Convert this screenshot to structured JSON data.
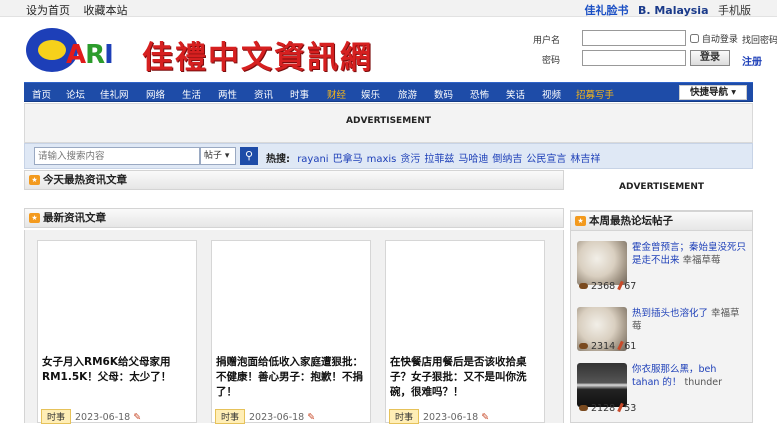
{
  "topbar": {
    "set_home": "设为首页",
    "bookmark": "收藏本站",
    "facebook": "佳礼脸书",
    "malaysia": "B. Malaysia",
    "mobile": "手机版"
  },
  "header": {
    "logo_text": "CARI",
    "site_name": "佳禮中文資訊網"
  },
  "login": {
    "username_label": "用户名",
    "password_label": "密码",
    "auto_login": "自动登录",
    "forgot": "找回密码",
    "login_btn": "登录",
    "register": "注册"
  },
  "nav": {
    "items": [
      "首页",
      "论坛",
      "佳礼网",
      "网络",
      "生活",
      "两性",
      "资讯",
      "时事",
      "财经",
      "娱乐",
      "旅游",
      "数码",
      "恐怖",
      "笑话",
      "视频",
      "招募写手"
    ],
    "highlight": [
      8,
      15
    ],
    "quick_nav": "快捷导航"
  },
  "ad": {
    "label": "ADVERTISEMENT"
  },
  "search": {
    "placeholder": "请输入搜索内容",
    "type": "帖子",
    "hot_label": "热搜:",
    "hot_terms": [
      "rayani",
      "巴拿马",
      "maxis",
      "贪污",
      "拉菲兹",
      "马哈迪",
      "倒纳吉",
      "公民宣言",
      "林吉祥"
    ]
  },
  "sections": {
    "today_hot": "今天最热资讯文章",
    "latest": "最新资讯文章",
    "weekly_forum": "本周最热论坛帖子"
  },
  "articles": [
    {
      "title": "女子月入RM6K给父母家用RM1.5K！父母：太少了！",
      "tag": "时事",
      "date": "2023-06-18"
    },
    {
      "title": "捐赠泡面给低收入家庭遭狠批：不健康！善心男子：抱歉！不捐了！",
      "tag": "时事",
      "date": "2023-06-18"
    },
    {
      "title": "在快餐店用餐后是否该收拾桌子？女子狠批：又不是叫你洗碗，很难吗？！",
      "tag": "时事",
      "date": "2023-06-18"
    }
  ],
  "forum_posts": [
    {
      "title": "霍金曾预言；秦始皇没死只是走不出来",
      "author": "幸福草莓",
      "views": "2368",
      "replies": "67"
    },
    {
      "title": "热到插头也溶化了",
      "author": "幸福草莓",
      "views": "2314",
      "replies": "61"
    },
    {
      "title": "你衣服那么黑，beh tahan 的！",
      "author": "thunder",
      "views": "2128",
      "replies": "53"
    }
  ]
}
